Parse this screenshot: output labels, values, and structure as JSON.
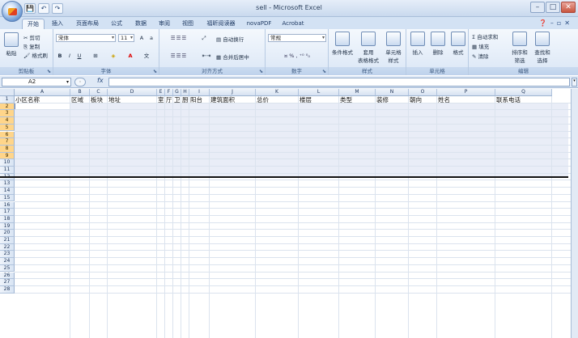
{
  "window": {
    "title": "sell - Microsoft Excel"
  },
  "qat": {
    "save": "💾",
    "undo": "↶",
    "redo": "↷"
  },
  "tabs": [
    "开始",
    "插入",
    "页面布局",
    "公式",
    "数据",
    "审阅",
    "视图",
    "福昕阅读器",
    "novaPDF",
    "Acrobat"
  ],
  "ribbon": {
    "clipboard": {
      "paste": "粘贴",
      "cut": "剪切",
      "copy": "复制",
      "format_painter": "格式刷",
      "label": "剪贴板"
    },
    "font": {
      "name": "宋体",
      "size": "11",
      "bold": "B",
      "italic": "I",
      "underline": "U",
      "label": "字体"
    },
    "align": {
      "wrap": "自动换行",
      "merge": "合并后居中",
      "label": "对齐方式"
    },
    "number": {
      "format": "常规",
      "label": "数字"
    },
    "styles": {
      "cond": "条件格式",
      "table": "套用\n表格格式",
      "cell": "单元格\n样式",
      "label": "样式"
    },
    "cells": {
      "insert": "插入",
      "delete": "删除",
      "format": "格式",
      "label": "单元格"
    },
    "edit": {
      "autosum": "自动求和",
      "fill": "填充",
      "clear": "清除",
      "sort": "排序和\n筛选",
      "find": "查找和\n选择",
      "label": "编辑"
    }
  },
  "formula_bar": {
    "name_box": "A2",
    "fx": "fx",
    "value": ""
  },
  "columns": [
    "A",
    "B",
    "C",
    "D",
    "E",
    "F",
    "G",
    "H",
    "I",
    "J",
    "K",
    "L",
    "M",
    "N",
    "O",
    "P",
    "Q"
  ],
  "rows": [
    "1",
    "2",
    "3",
    "4",
    "5",
    "6",
    "7",
    "8",
    "9",
    "10",
    "11",
    "12",
    "13",
    "14",
    "15",
    "16",
    "17",
    "18",
    "19",
    "20",
    "21",
    "22",
    "23",
    "24",
    "25",
    "26",
    "27",
    "28"
  ],
  "row1": {
    "A": "小区名称",
    "B": "区域",
    "C": "板块",
    "D": "地址",
    "E": "室",
    "F": "厅",
    "G": "卫",
    "H": "厨",
    "I": "阳台",
    "J": "建筑面积",
    "K": "总价",
    "L": "楼层",
    "M": "类型",
    "N": "装修",
    "O": "朝向",
    "P": "姓名",
    "Q": "联系电话"
  }
}
